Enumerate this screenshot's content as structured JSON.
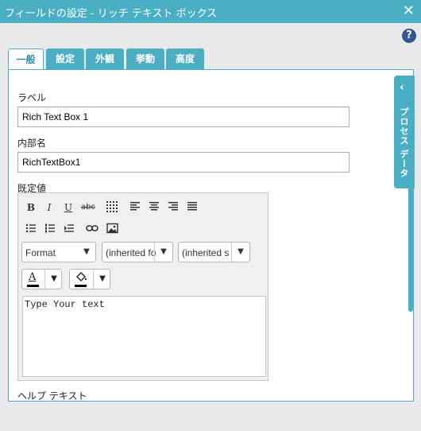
{
  "dialog": {
    "title": "フィールドの設定 - リッチ テキスト ボックス",
    "close_icon": "close-icon",
    "help_icon": "help-icon"
  },
  "tabs": [
    {
      "label": "一般",
      "active": true
    },
    {
      "label": "設定",
      "active": false
    },
    {
      "label": "外観",
      "active": false
    },
    {
      "label": "挙動",
      "active": false
    },
    {
      "label": "高度",
      "active": false
    }
  ],
  "fields": {
    "label_caption": "ラベル",
    "label_value": "Rich Text Box 1",
    "internal_name_caption": "内部名",
    "internal_name_value": "RichTextBox1",
    "default_caption": "既定値",
    "help_caption": "ヘルプ テキスト"
  },
  "editor": {
    "bold": "B",
    "italic": "I",
    "underline": "U",
    "strike": "abc",
    "format_value": "Format",
    "font_value": "(inherited fo",
    "size_value": "(inherited s",
    "text_color_glyph": "A",
    "content": "Type Your text"
  },
  "side_panel": {
    "label": "プロセス データ"
  },
  "colors": {
    "accent": "#4aaec5",
    "help": "#2f5a8f"
  }
}
